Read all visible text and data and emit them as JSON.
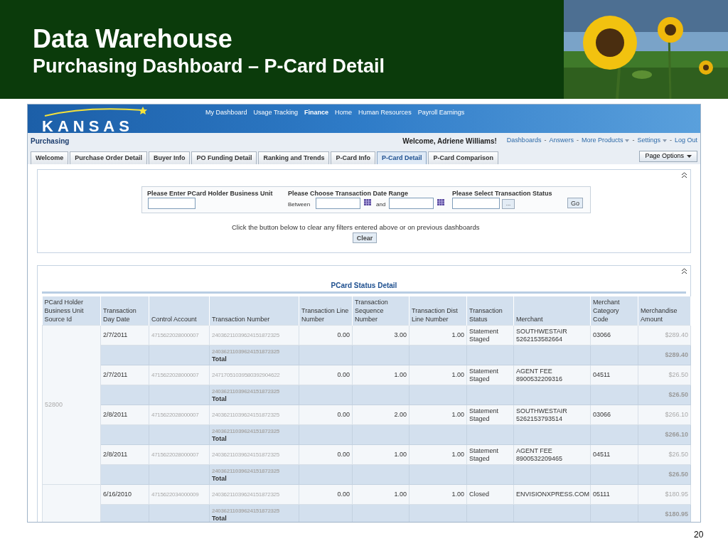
{
  "slide": {
    "title": "Data Warehouse",
    "subtitle": "Purchasing Dashboard – P-Card Detail",
    "page_number": "20"
  },
  "app": {
    "logo": "KANSAS",
    "top_nav": [
      {
        "label": "My Dashboard",
        "selected": false
      },
      {
        "label": "Usage Tracking",
        "selected": false
      },
      {
        "label": "Finance",
        "selected": true
      },
      {
        "label": "Home",
        "selected": false
      },
      {
        "label": "Human Resources",
        "selected": false
      },
      {
        "label": "Payroll Earnings",
        "selected": false
      }
    ],
    "section": "Purchasing",
    "welcome": "Welcome, Adriene Williams!",
    "links": [
      {
        "label": "Dashboards",
        "menu": false
      },
      {
        "prefix": "-",
        "label": "Answers",
        "menu": false
      },
      {
        "prefix": "-",
        "label": "More Products",
        "menu": true
      },
      {
        "prefix": "-",
        "label": "Settings",
        "menu": true
      },
      {
        "prefix": "-",
        "label": "Log Out",
        "menu": false
      }
    ],
    "tabs": [
      {
        "label": "Welcome",
        "selected": false
      },
      {
        "label": "Purchase Order Detail",
        "selected": false
      },
      {
        "label": "Buyer Info",
        "selected": false
      },
      {
        "label": "PO Funding Detail",
        "selected": false
      },
      {
        "label": "Ranking and Trends",
        "selected": false
      },
      {
        "label": "P-Card Info",
        "selected": false
      },
      {
        "label": "P-Card Detail",
        "selected": true
      },
      {
        "label": "P-Card Comparison",
        "selected": false
      }
    ],
    "page_options": "Page Options",
    "filters": {
      "business_unit_label": "Please Enter PCard Holder Business Unit",
      "date_range_label": "Please Choose Transaction Date Range",
      "between": "Between",
      "and": "and",
      "status_label": "Please Select Transaction Status",
      "browse_button": "...",
      "go_button": "Go",
      "clear_note": "Click the button below to clear any filters entered above or on previous dashboards",
      "clear_button": "Clear"
    },
    "report": {
      "title": "PCard Status Detail",
      "columns": [
        "PCard Holder Business Unit Source Id",
        "Transaction Day Date",
        "Control Account",
        "Transaction Number",
        "Transaction Line Number",
        "Transaction Sequence Number",
        "Transaction Dist Line Number",
        "Transaction Status",
        "Merchant",
        "Merchant Category Code",
        "Merchandise Amount"
      ],
      "groups": [
        {
          "source_id": "52800",
          "transactions": [
            {
              "date": "2/7/2011",
              "control_account": "4715622028000007",
              "number": "24036211039624151872325",
              "line": "0.00",
              "sequence": "3.00",
              "dist_line": "1.00",
              "status": "Statement Staged",
              "merchant": "SOUTHWESTAIR 5262153582664",
              "category": "03066",
              "amount": "$289.40",
              "total_number": "24036211039624151872325",
              "total_label": "Total",
              "total_amount": "$289.40"
            },
            {
              "date": "2/7/2011",
              "control_account": "4715622028000007",
              "number": "24717051039580392904622",
              "line": "0.00",
              "sequence": "1.00",
              "dist_line": "1.00",
              "status": "Statement Staged",
              "merchant": "AGENT FEE 8900532209316",
              "category": "04511",
              "amount": "$26.50",
              "total_number": "24036211039624151872325",
              "total_label": "Total",
              "total_amount": "$26.50"
            },
            {
              "date": "2/8/2011",
              "control_account": "4715622028000007",
              "number": "24036211039624151872325",
              "line": "0.00",
              "sequence": "2.00",
              "dist_line": "1.00",
              "status": "Statement Staged",
              "merchant": "SOUTHWESTAIR 5262153793514",
              "category": "03066",
              "amount": "$266.10",
              "total_number": "24036211039624151872325",
              "total_label": "Total",
              "total_amount": "$266.10"
            },
            {
              "date": "2/8/2011",
              "control_account": "4715622028000007",
              "number": "24036211039624151872325",
              "line": "0.00",
              "sequence": "1.00",
              "dist_line": "1.00",
              "status": "Statement Staged",
              "merchant": "AGENT FEE 8900532209465",
              "category": "04511",
              "amount": "$26.50",
              "total_number": "24036211039624151872325",
              "total_label": "Total",
              "total_amount": "$26.50"
            }
          ]
        },
        {
          "transactions": [
            {
              "date": "6/16/2010",
              "control_account": "4715622034000009",
              "number": "24036211039624151872325",
              "line": "0.00",
              "sequence": "1.00",
              "dist_line": "1.00",
              "status": "Closed",
              "merchant": "ENVISIONXPRESS.COM",
              "category": "05111",
              "amount": "$180.95",
              "total_number": "24036211039624151872325",
              "total_label": "Total",
              "total_amount": "$180.95"
            }
          ]
        }
      ]
    }
  }
}
